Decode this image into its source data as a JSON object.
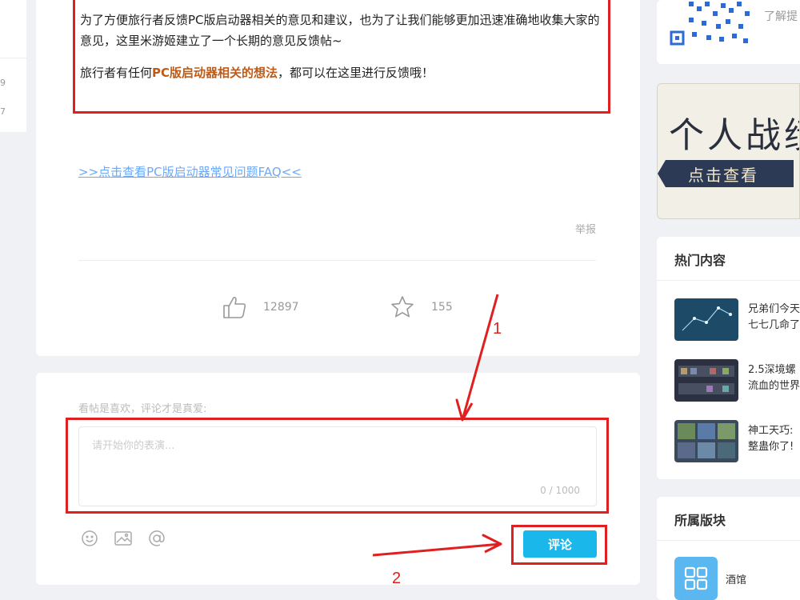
{
  "left_fragment": {
    "texts": [
      "9",
      "7"
    ]
  },
  "post": {
    "intro_p1": "为了方便旅行者反馈PC版启动器相关的意见和建议，也为了让我们能够更加迅速准确地收集大家的意见，这里米游姬建立了一个长期的意见反馈帖~",
    "intro_p2_prefix": "旅行者有任何",
    "intro_p2_highlight": "PC版启动器相关的想法",
    "intro_p2_suffix": "，都可以在这里进行反馈哦！",
    "faq_link": ">>点击查看PC版启动器常见问题FAQ<<",
    "report": "举报",
    "like_count": "12897",
    "fav_count": "155",
    "like_icon": "thumbs-up-icon",
    "fav_icon": "star-icon"
  },
  "comment": {
    "hint": "看帖是喜欢，评论才是真爱:",
    "placeholder": "请开始你的表演...",
    "counter": "0 / 1000",
    "tools": [
      "emoji-icon",
      "image-icon",
      "at-icon"
    ],
    "submit_label": "评论"
  },
  "annotations": {
    "label_1": "1",
    "label_2": "2",
    "color": "#e02020"
  },
  "sidebar": {
    "qr_text": "了解提",
    "banner_title": "个人战绩",
    "banner_button": "点击查看",
    "hot": {
      "title": "热门内容",
      "items": [
        {
          "line1": "兄弟们今天",
          "line2": "七七几命了"
        },
        {
          "line1": "2.5深境螺",
          "line2": "流血的世界"
        },
        {
          "line1": "神工天巧:",
          "line2": "整蛊你了!"
        }
      ]
    },
    "forum": {
      "title": "所属版块",
      "name": "酒馆"
    }
  },
  "colors": {
    "accent": "#1ab7ea",
    "highlight": "#c05a14",
    "link": "#6ea8f5",
    "annotation": "#e02020"
  }
}
